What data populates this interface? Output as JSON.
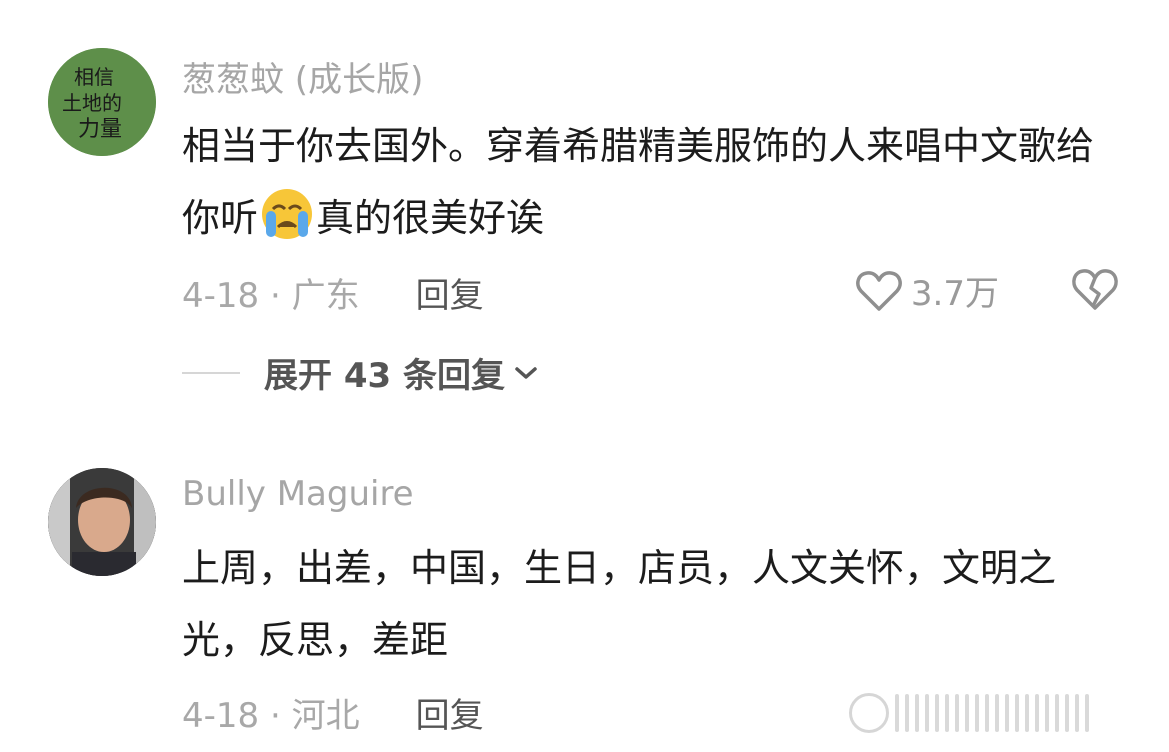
{
  "comments": [
    {
      "avatar_text": [
        "相信",
        "土地的",
        "力量"
      ],
      "username": "葱葱蚊 (成长版)",
      "text_before_emoji": "相当于你去国外。穿着希腊精美服饰的人来唱中文歌给你听",
      "emoji": "loudly-crying-face",
      "text_after_emoji": "真的很美好诶",
      "date_location": "4-18 · 广东",
      "reply_label": "回复",
      "likes": "3.7万",
      "expand_replies": "展开 43 条回复"
    },
    {
      "username": "Bully Maguire",
      "text": "上周，出差，中国，生日，店员，人文关怀，文明之光，反思，差距",
      "date_location": "4-18 · 河北",
      "reply_label": "回复"
    }
  ],
  "colors": {
    "username": "#a6a6a6",
    "body": "#1c1c1c",
    "meta": "#a8a8a8",
    "avatar_green": "#5e8f4a"
  }
}
